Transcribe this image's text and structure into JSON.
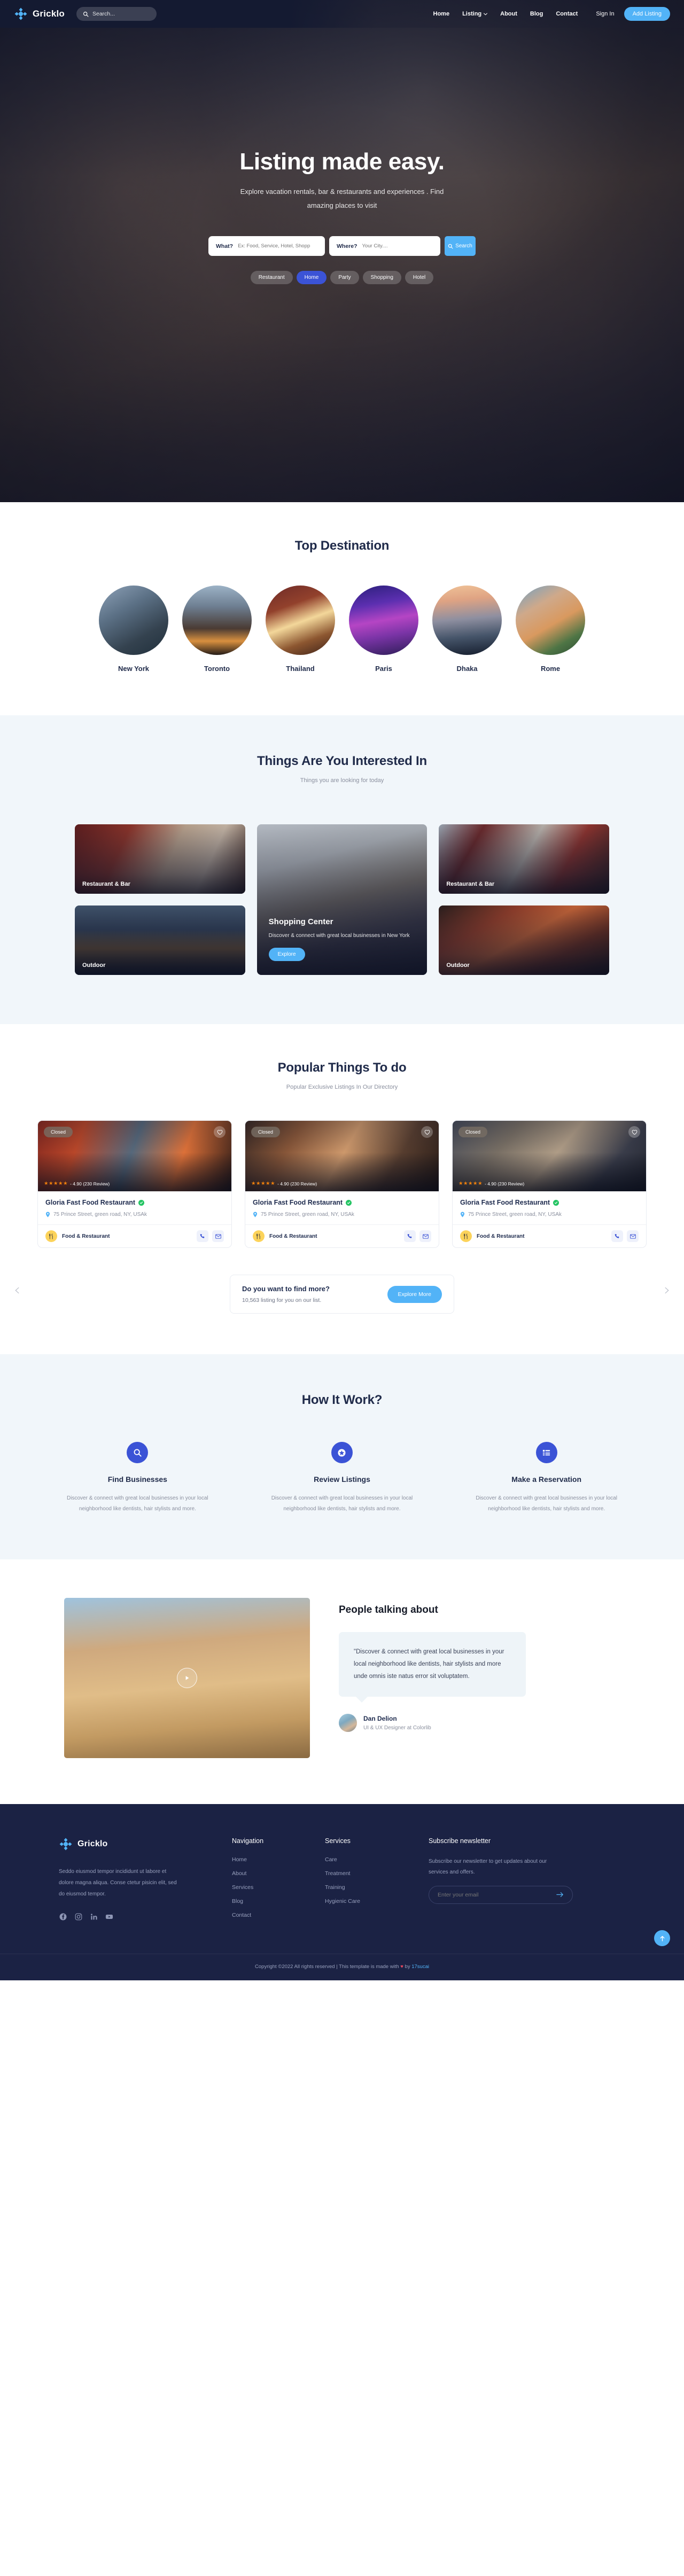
{
  "brand": {
    "name": "Gricklo"
  },
  "nav": {
    "search_placeholder": "Search...",
    "menu": [
      {
        "label": "Home",
        "has_caret": false
      },
      {
        "label": "Listing",
        "has_caret": true
      },
      {
        "label": "About",
        "has_caret": false
      },
      {
        "label": "Blog",
        "has_caret": false
      },
      {
        "label": "Contact",
        "has_caret": false
      }
    ],
    "signin_label": "Sign In",
    "add_listing_label": "Add Listing"
  },
  "hero": {
    "title": "Listing made easy.",
    "subtitle": "Explore vacation rentals, bar & restaurants and experiences . Find amazing places to visit",
    "search": {
      "what_label": "What?",
      "what_placeholder": "Ex: Food, Service, Hotel, Shopp",
      "where_label": "Where?",
      "where_placeholder": "Your City....",
      "button_label": "Search"
    },
    "pills": [
      {
        "label": "Restaurant",
        "active": false
      },
      {
        "label": "Home",
        "active": true
      },
      {
        "label": "Party",
        "active": false
      },
      {
        "label": "Shopping",
        "active": false
      },
      {
        "label": "Hotel",
        "active": false
      }
    ]
  },
  "destinations": {
    "title": "Top Destination",
    "items": [
      {
        "name": "New York",
        "ph": "ph-ny"
      },
      {
        "name": "Toronto",
        "ph": "ph-toronto"
      },
      {
        "name": "Thailand",
        "ph": "ph-thailand"
      },
      {
        "name": "Paris",
        "ph": "ph-paris"
      },
      {
        "name": "Dhaka",
        "ph": "ph-dhaka"
      },
      {
        "name": "Rome",
        "ph": "ph-rome"
      }
    ]
  },
  "interested": {
    "title": "Things Are You Interested In",
    "subtitle": "Things you are looking for today",
    "cards": [
      {
        "label": "Restaurant & Bar",
        "ph": "ph-resto1"
      },
      {
        "label": "Outdoor",
        "ph": "ph-outdoor1"
      },
      {
        "label": "Restaurant & Bar",
        "ph": "ph-resto2"
      },
      {
        "label": "Outdoor",
        "ph": "ph-outdoor2"
      }
    ],
    "feature": {
      "title": "Shopping Center",
      "desc": "Discover & connect with great local businesses in New York",
      "button_label": "Explore",
      "ph": "ph-shop"
    }
  },
  "popular": {
    "title": "Popular Things To do",
    "subtitle": "Popular Exclusive Listings In Our Directory",
    "prev_icon": "chevron-left",
    "next_icon": "chevron-right",
    "listings": [
      {
        "status": "Closed",
        "stars": "★★★★★",
        "rating_text": "- 4.90 (230 Review)",
        "name": "Gloria Fast Food Restaurant",
        "address": "75 Prince Street, green road, NY, USAk",
        "category": "Food & Restaurant",
        "ph": "ph-card1"
      },
      {
        "status": "Closed",
        "stars": "★★★★★",
        "rating_text": "- 4.90 (230 Review)",
        "name": "Gloria Fast Food Restaurant",
        "address": "75 Prince Street, green road, NY, USAk",
        "category": "Food & Restaurant",
        "ph": "ph-card2"
      },
      {
        "status": "Closed",
        "stars": "★★★★★",
        "rating_text": "- 4.90 (230 Review)",
        "name": "Gloria Fast Food Restaurant",
        "address": "75 Prince Street, green road, NY, USAk",
        "category": "Food & Restaurant",
        "ph": "ph-card3"
      }
    ],
    "cta": {
      "title": "Do you want to find more?",
      "desc": "10,563 listing for you on our list.",
      "button_label": "Explore More"
    }
  },
  "howitwork": {
    "title": "How It Work?",
    "steps": [
      {
        "icon": "search-icon",
        "title": "Find Businesses",
        "desc": "Discover & connect with great local businesses in your local neighborhood like dentists, hair stylists and more."
      },
      {
        "icon": "star-badge-icon",
        "title": "Review Listings",
        "desc": "Discover & connect with great local businesses in your local neighborhood like dentists, hair stylists and more."
      },
      {
        "icon": "list-icon",
        "title": "Make a Reservation",
        "desc": "Discover & connect with great local businesses in your local neighborhood like dentists, hair stylists and more."
      }
    ]
  },
  "testimonial": {
    "heading": "People talking about",
    "quote": "\"Discover & connect with great local businesses in your local neighborhood like dentists, hair stylists and more unde omnis iste natus error sit voluptatem.",
    "author_name": "Dan Delion",
    "author_role": "UI & UX Designer at Colorlib",
    "play_icon": "play-icon"
  },
  "footer": {
    "about": "Seddo eiusmod tempor incididunt ut labore et dolore magna aliqua. Conse ctetur pisicin elit, sed do eiusmod tempor.",
    "socials": [
      "facebook-icon",
      "instagram-icon",
      "linkedin-icon",
      "youtube-icon"
    ],
    "columns": [
      {
        "heading": "Navigation",
        "links": [
          "Home",
          "About",
          "Services",
          "Blog",
          "Contact"
        ]
      },
      {
        "heading": "Services",
        "links": [
          "Care",
          "Treatment",
          "Training",
          "Hygienic Care"
        ]
      }
    ],
    "newsletter": {
      "heading": "Subscribe newsletter",
      "desc": "Subscribe our newsletter to get updates about our services and offers.",
      "placeholder": "Enter your email",
      "submit_icon": "arrow-right-icon"
    },
    "copyright_pre": "Copyright ©2022 All rights reserved | This template is made with ",
    "copyright_heart": "♥",
    "copyright_mid": " by ",
    "copyright_link": "17sucai",
    "to_top_icon": "arrow-up-icon"
  },
  "colors": {
    "accent_blue": "#52b3f7",
    "deep_blue": "#3b53d6",
    "navy": "#1b2244",
    "star_orange": "#f2820c",
    "verified_green": "#24c463",
    "category_yellow": "#fcd35a"
  }
}
